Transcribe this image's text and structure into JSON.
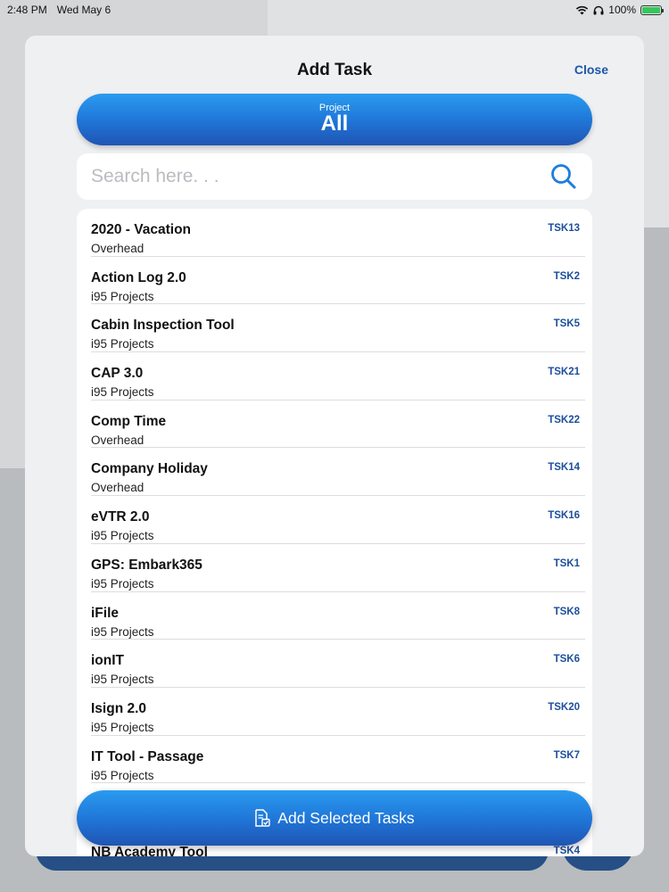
{
  "status_bar": {
    "time": "2:48 PM",
    "date": "Wed May 6",
    "battery_percent": "100%",
    "battery_level": 1.0
  },
  "sheet": {
    "title": "Add Task",
    "close_label": "Close"
  },
  "project_selector": {
    "label": "Project",
    "value": "All"
  },
  "search": {
    "placeholder": "Search here. . .",
    "value": ""
  },
  "tasks": [
    {
      "name": "2020 - Vacation",
      "category": "Overhead",
      "code": "TSK13"
    },
    {
      "name": "Action Log 2.0",
      "category": "i95 Projects",
      "code": "TSK2"
    },
    {
      "name": "Cabin Inspection Tool",
      "category": "i95 Projects",
      "code": "TSK5"
    },
    {
      "name": "CAP 3.0",
      "category": "i95 Projects",
      "code": "TSK21"
    },
    {
      "name": "Comp Time",
      "category": "Overhead",
      "code": "TSK22"
    },
    {
      "name": "Company Holiday",
      "category": "Overhead",
      "code": "TSK14"
    },
    {
      "name": "eVTR 2.0",
      "category": "i95 Projects",
      "code": "TSK16"
    },
    {
      "name": "GPS: Embark365",
      "category": "i95 Projects",
      "code": "TSK1"
    },
    {
      "name": "iFile",
      "category": "i95 Projects",
      "code": "TSK8"
    },
    {
      "name": "ionIT",
      "category": "i95 Projects",
      "code": "TSK6"
    },
    {
      "name": "Isign 2.0",
      "category": "i95 Projects",
      "code": "TSK20"
    },
    {
      "name": "IT Tool - Passage",
      "category": "i95 Projects",
      "code": "TSK7"
    },
    {
      "name": "",
      "category": "",
      "code": ""
    },
    {
      "name": "NB Academy Tool",
      "category": "",
      "code": "TSK4"
    }
  ],
  "add_button": {
    "label": "Add Selected Tasks"
  },
  "colors": {
    "accent": "#1f74d6",
    "code_text": "#1c4f9c",
    "sheet_bg": "#eff0f2"
  }
}
